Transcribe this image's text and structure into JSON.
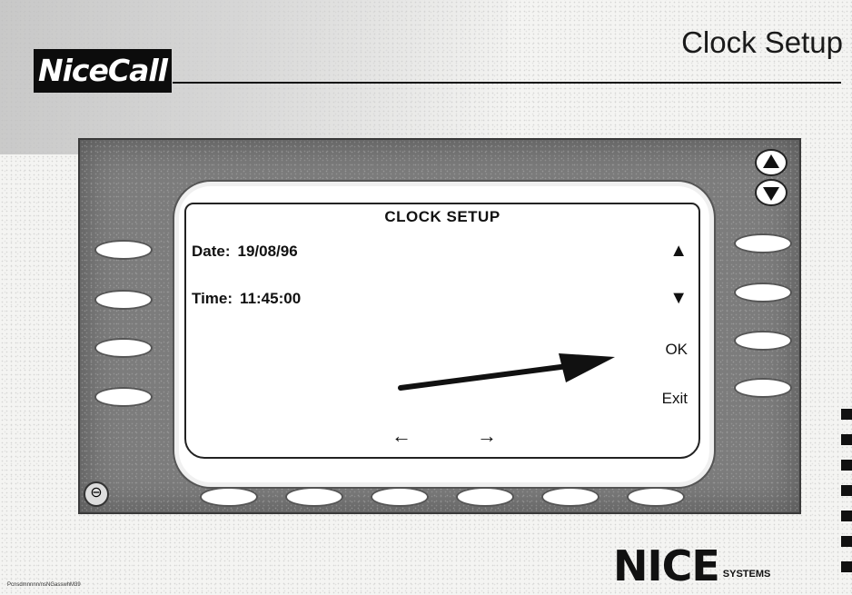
{
  "header": {
    "logo_text": "NiceCall",
    "page_title": "Clock Setup"
  },
  "screen": {
    "title": "CLOCK SETUP",
    "date_label": "Date:",
    "date_value": "19/08/96",
    "time_label": "Time:",
    "time_value": "11:45:00",
    "softkeys": {
      "up": "▲",
      "down": "▼",
      "ok": "OK",
      "exit": "Exit"
    },
    "nav": {
      "left": "←",
      "right": "→"
    }
  },
  "footer": {
    "brand": "NICE",
    "brand_suffix": "SYSTEMS",
    "tiny_text": "Pcnsdmnnnn/nsNGasswhM39"
  },
  "icons": {
    "scroll_up": "triangle-up-icon",
    "scroll_down": "triangle-down-icon",
    "mini_button": "circle-minus-icon"
  }
}
